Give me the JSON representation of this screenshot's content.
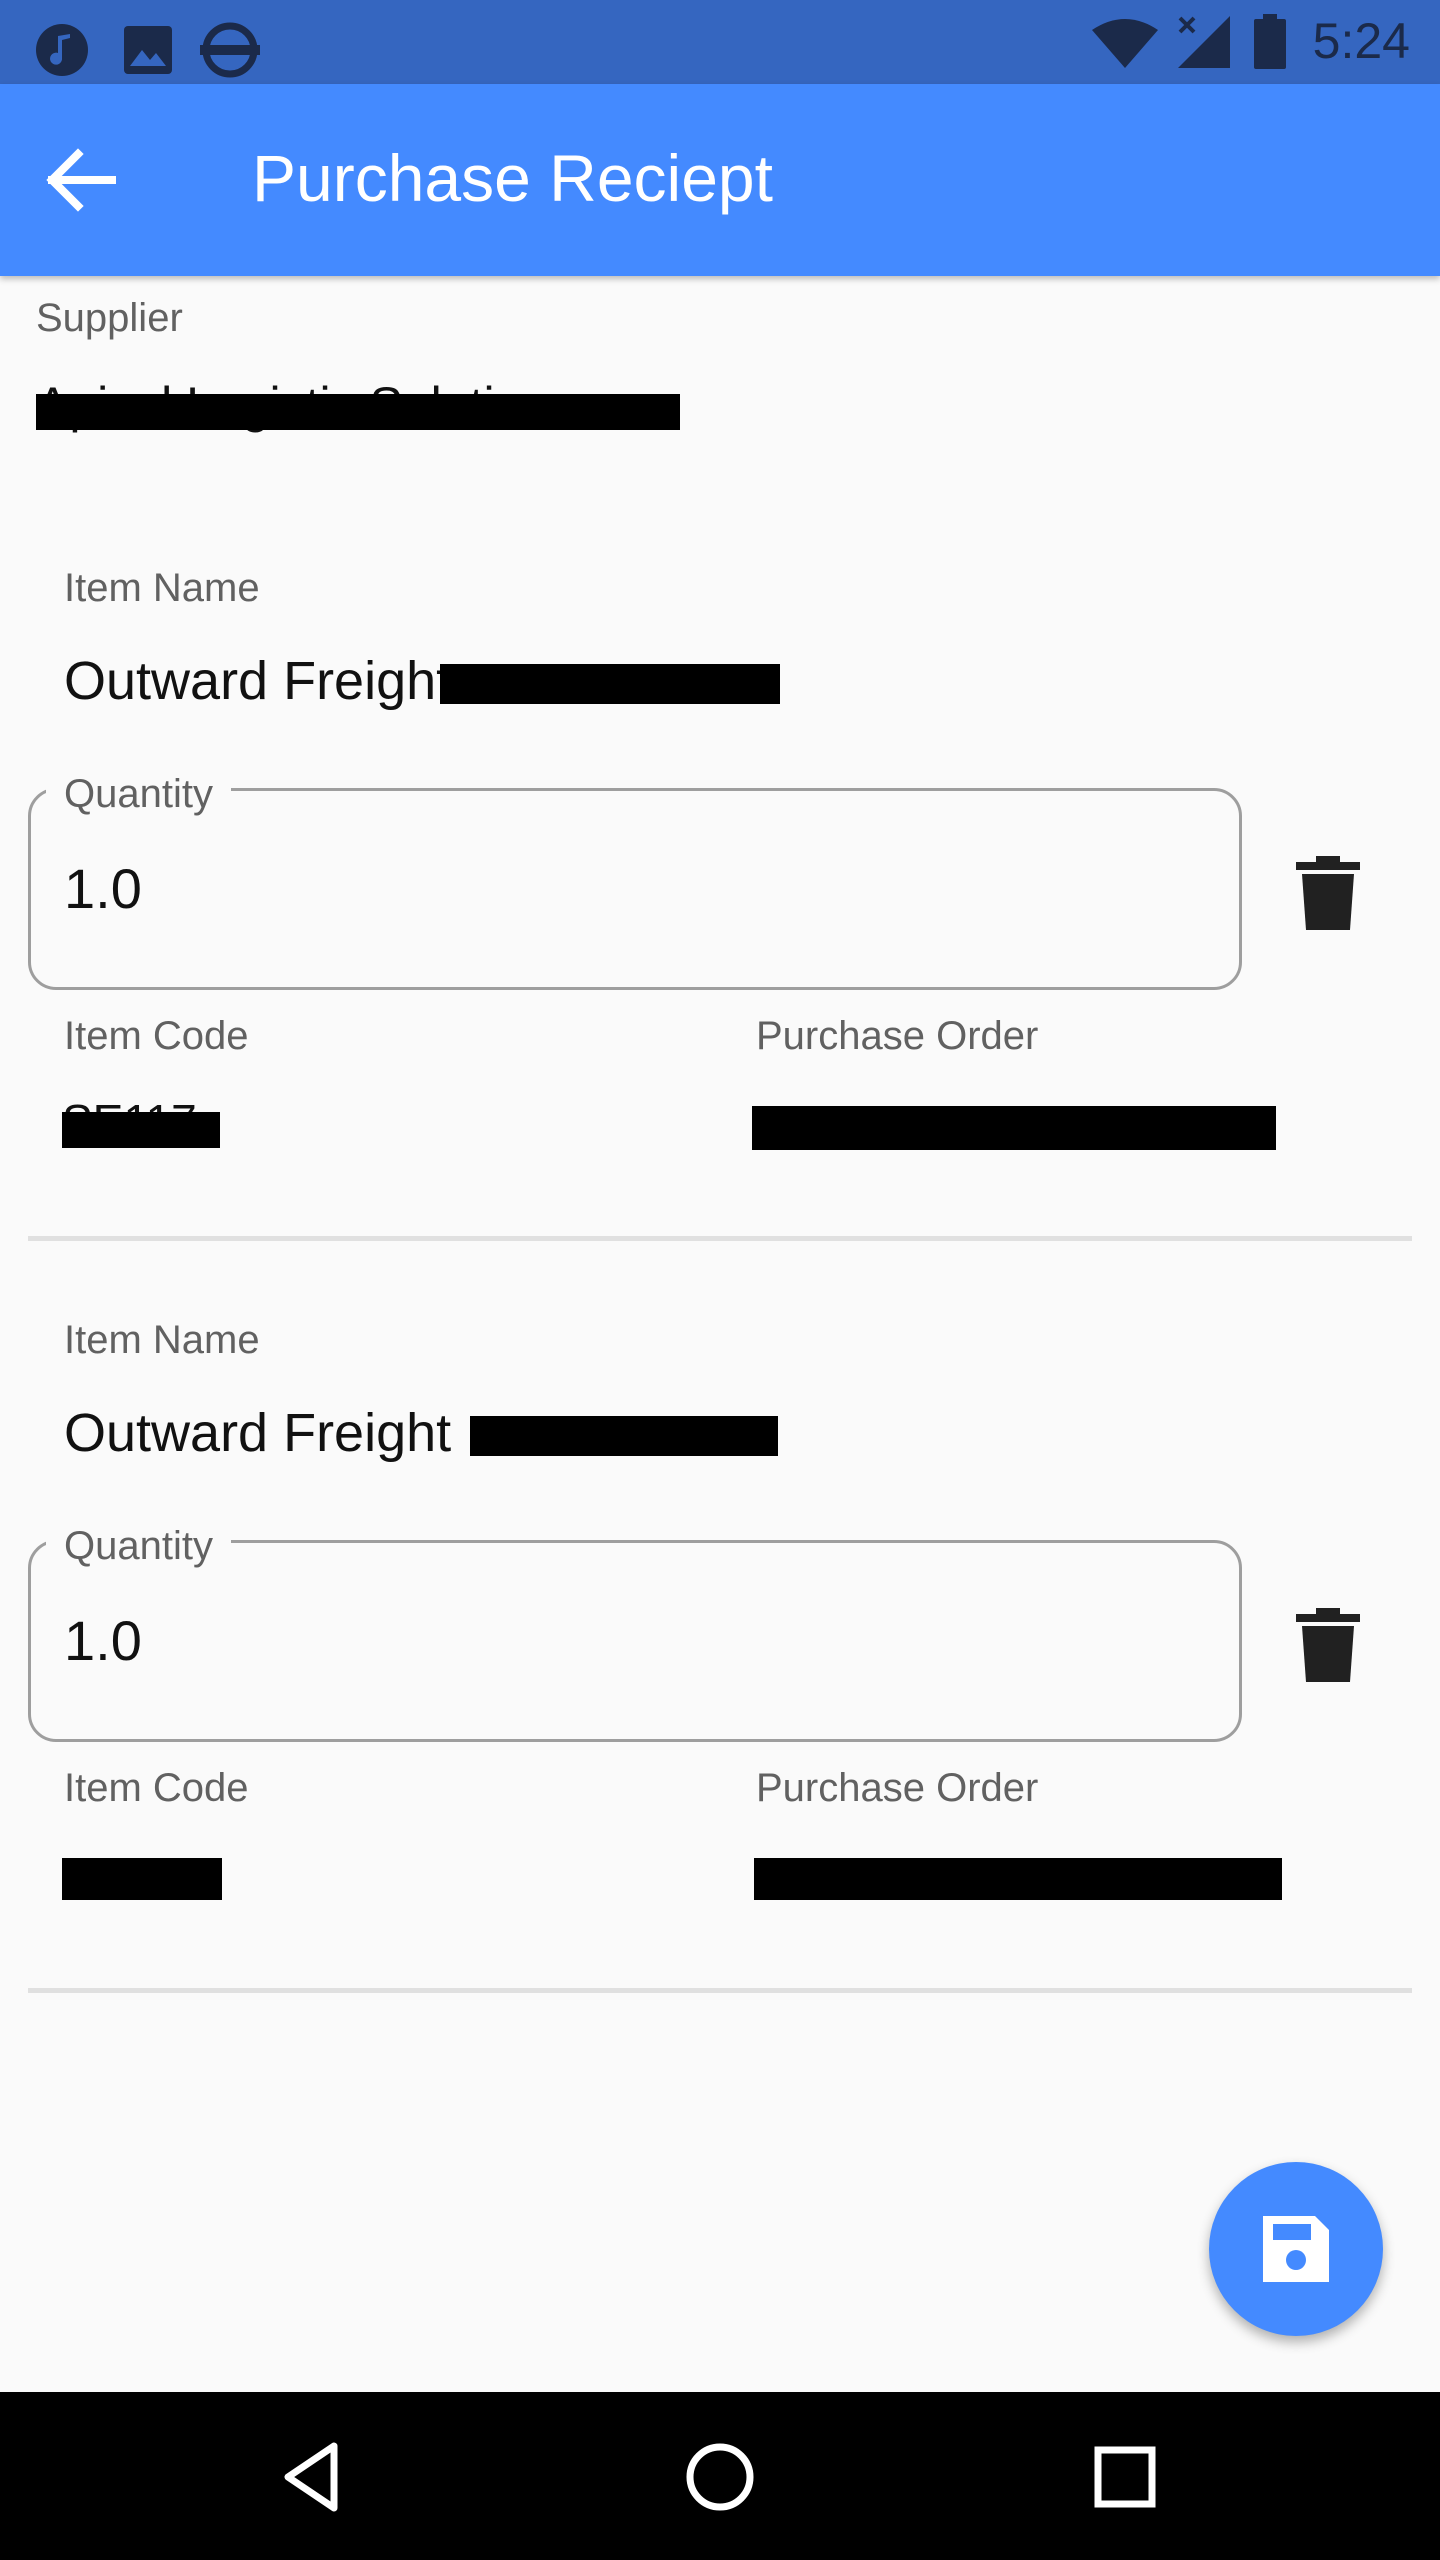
{
  "status_bar": {
    "time": "5:24",
    "left_icons": [
      "music-note-icon",
      "image-icon",
      "subway-icon"
    ],
    "right_icons": [
      "wifi-icon",
      "signal-icon",
      "battery-icon"
    ]
  },
  "app_bar": {
    "title": "Purchase Reciept",
    "back_icon": "arrow-back-icon",
    "color": "#448aff"
  },
  "supplier": {
    "label": "Supplier",
    "value": "Apical Logistic Solutions"
  },
  "items": [
    {
      "name_label": "Item Name",
      "name_value": "Outward Freight",
      "quantity_label": "Quantity",
      "quantity_value": "1.0",
      "code_label": "Item Code",
      "code_value": "SE117",
      "po_label": "Purchase Order"
    },
    {
      "name_label": "Item Name",
      "name_value": "Outward Freight",
      "quantity_label": "Quantity",
      "quantity_value": "1.0",
      "code_label": "Item Code",
      "po_label": "Purchase Order"
    }
  ],
  "fab": {
    "icon": "save-icon"
  },
  "nav_bar": {
    "icons": [
      "back-triangle-icon",
      "home-circle-icon",
      "recents-square-icon"
    ]
  }
}
